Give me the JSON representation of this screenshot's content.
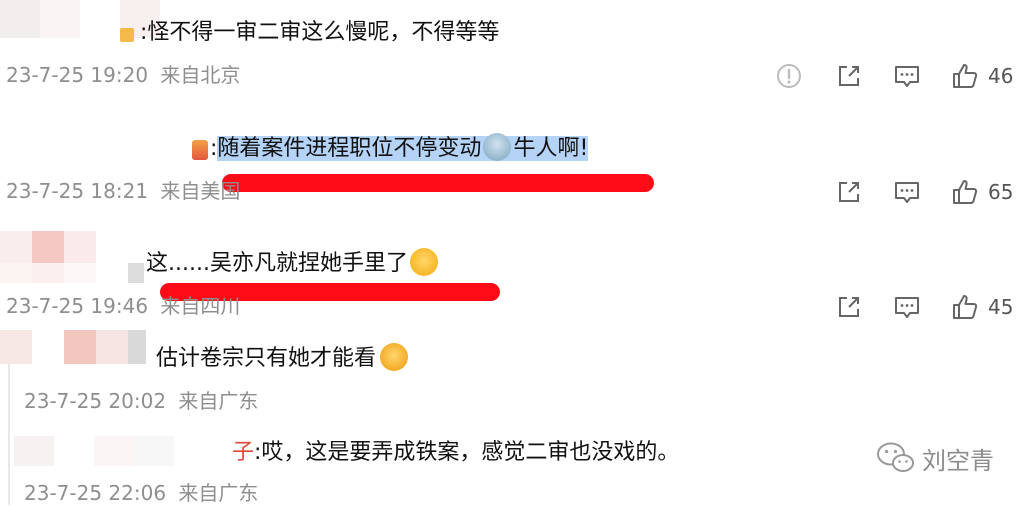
{
  "comments": [
    {
      "text": ":怪不得一审二审这么慢呢，不得等等",
      "time": "23-7-25 19:20",
      "location": "来自北京",
      "likes": "46"
    },
    {
      "text_highlighted": "随着案件进程职位不停变动",
      "text_prefix": ":",
      "text_suffix": "牛人啊!",
      "time": "23-7-25 18:21",
      "location": "来自美国",
      "likes": "65"
    },
    {
      "text_prefix": "这......吴亦凡就捏她手里了",
      "time": "23-7-25 19:46",
      "location": "来自四川",
      "likes": "45"
    }
  ],
  "replies": [
    {
      "text": "估计卷宗只有她才能看",
      "time": "23-7-25 20:02",
      "location": "来自广东"
    },
    {
      "name_tail": "子",
      "text": ":哎，这是要弄成铁案，感觉二审也没戏的。",
      "time": "23-7-25 22:06",
      "location": "来自广东"
    }
  ],
  "watermark": {
    "text": "刘空青",
    "icon": "wechat-icon"
  },
  "icons": [
    "report-icon",
    "share-icon",
    "comment-icon",
    "like-icon"
  ],
  "colors": {
    "highlight": "#b4d3f7",
    "red_mark": "#ff0a17",
    "meta_text": "#8e8e8e"
  }
}
